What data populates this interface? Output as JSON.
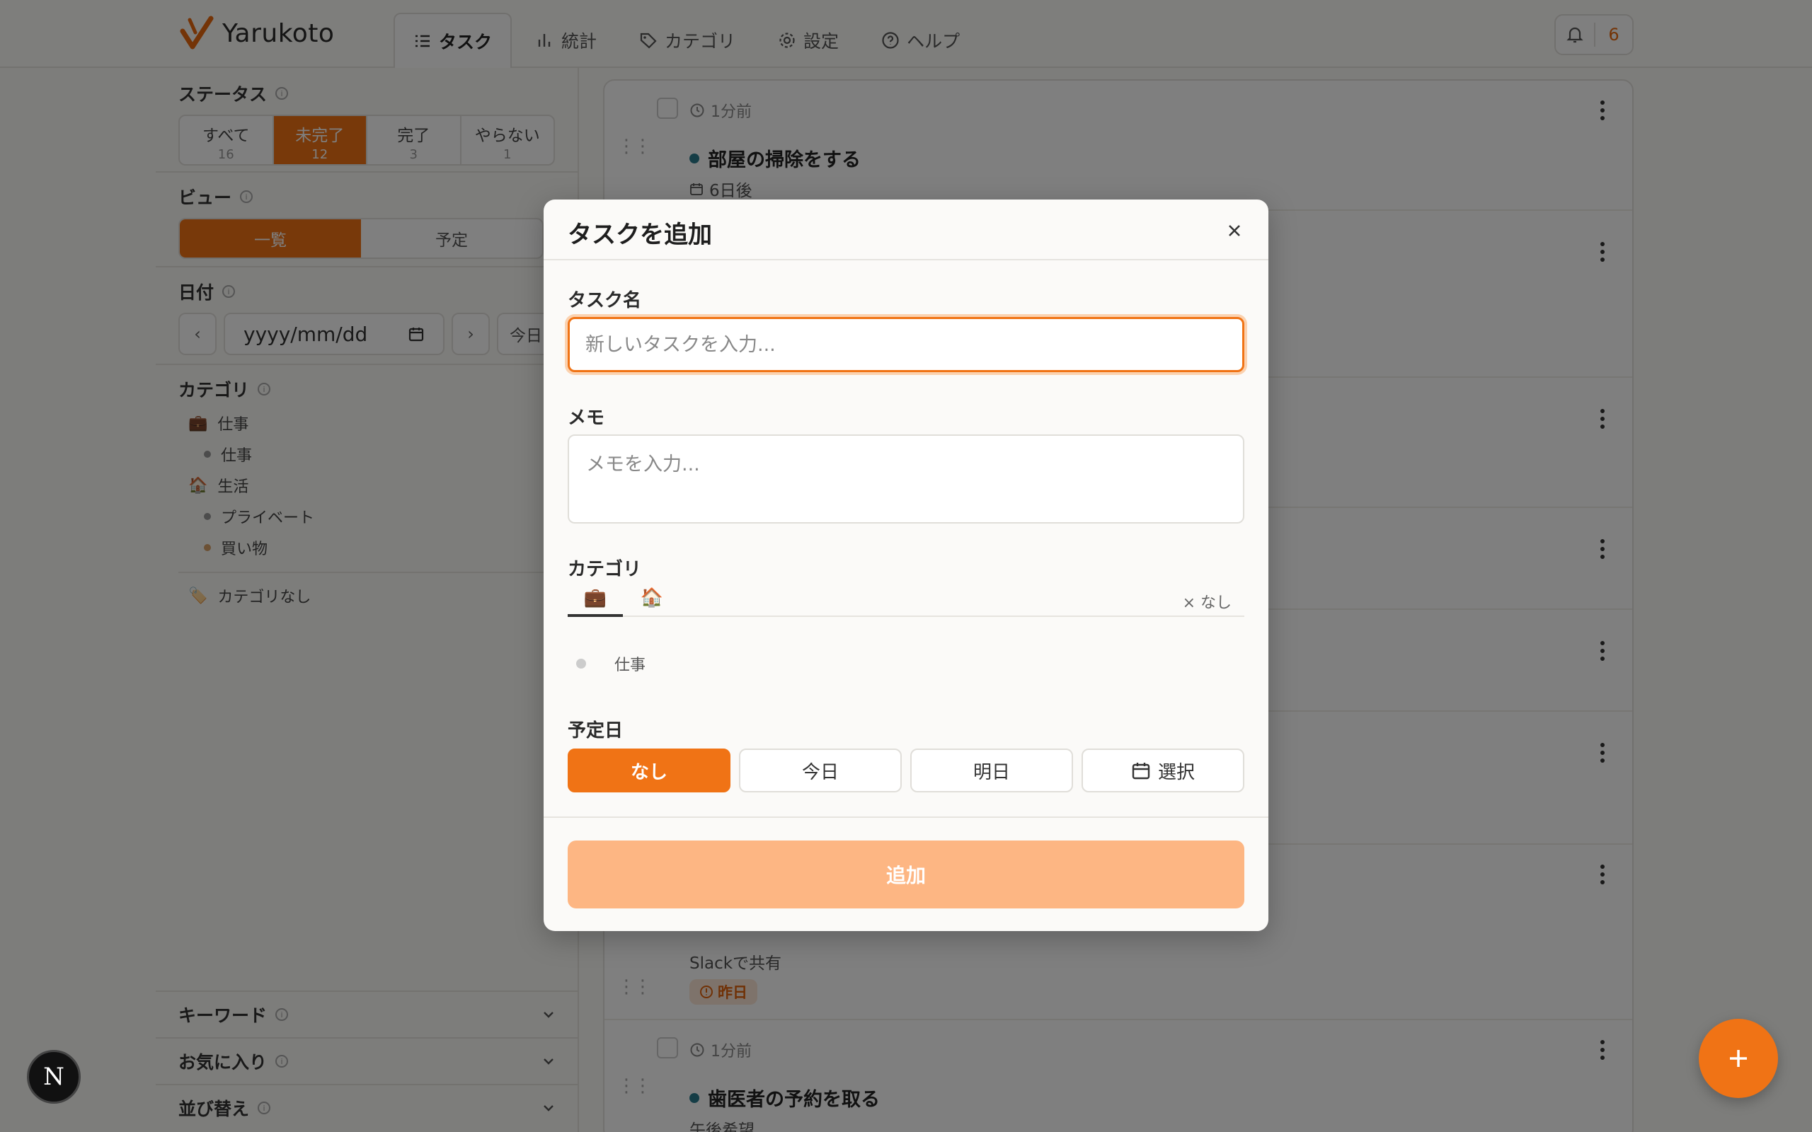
{
  "app": {
    "name": "Yarukoto"
  },
  "nav": [
    {
      "label": "タスク",
      "icon": "task-list-icon",
      "active": true
    },
    {
      "label": "統計",
      "icon": "bar-chart-icon",
      "active": false
    },
    {
      "label": "カテゴリ",
      "icon": "tag-icon",
      "active": false
    },
    {
      "label": "設定",
      "icon": "gear-icon",
      "active": false
    },
    {
      "label": "ヘルプ",
      "icon": "help-circle-icon",
      "active": false
    }
  ],
  "notifications": {
    "count": "6"
  },
  "sidebar": {
    "status": {
      "title": "ステータス",
      "options": [
        {
          "label": "すべて",
          "count": "16"
        },
        {
          "label": "未完了",
          "count": "12"
        },
        {
          "label": "完了",
          "count": "3"
        },
        {
          "label": "やらない",
          "count": "1"
        }
      ],
      "selected": "未完了"
    },
    "view": {
      "title": "ビュー",
      "options": [
        "一覧",
        "予定"
      ],
      "selected": "一覧"
    },
    "date": {
      "title": "日付",
      "placeholder": "yyyy/mm/dd",
      "today_label": "今日"
    },
    "category": {
      "title": "カテゴリ",
      "groups": [
        {
          "icon": "💼",
          "label": "仕事",
          "children": [
            "仕事"
          ]
        },
        {
          "icon": "🏠",
          "label": "生活",
          "children": [
            "プライベート",
            "買い物"
          ]
        }
      ],
      "none_icon": "🏷️",
      "none_label": "カテゴリなし"
    },
    "collapsibles": [
      {
        "label": "キーワード"
      },
      {
        "label": "お気に入り"
      },
      {
        "label": "並び替え"
      }
    ]
  },
  "tasks": [
    {
      "meta": "1分前",
      "title": "部屋の掃除をする",
      "due": "6日後"
    },
    {
      "memo": "Slackで共有",
      "badge": "昨日"
    },
    {
      "meta": "1分前",
      "title": "歯医者の予約を取る",
      "memo": "午後希望"
    }
  ],
  "modal": {
    "title": "タスクを追加",
    "name_label": "タスク名",
    "name_placeholder": "新しいタスクを入力...",
    "memo_label": "メモ",
    "memo_placeholder": "メモを入力...",
    "category_label": "カテゴリ",
    "category_tabs": [
      "💼",
      "🏠"
    ],
    "category_none": "× なし",
    "subcategory": "仕事",
    "due_label": "予定日",
    "due_options": [
      "なし",
      "今日",
      "明日",
      "選択"
    ],
    "due_selected": "なし",
    "submit_label": "追加"
  },
  "colors": {
    "accent": "#f07315",
    "accent_soft": "#fdb683",
    "overdue": "#e0620c"
  }
}
